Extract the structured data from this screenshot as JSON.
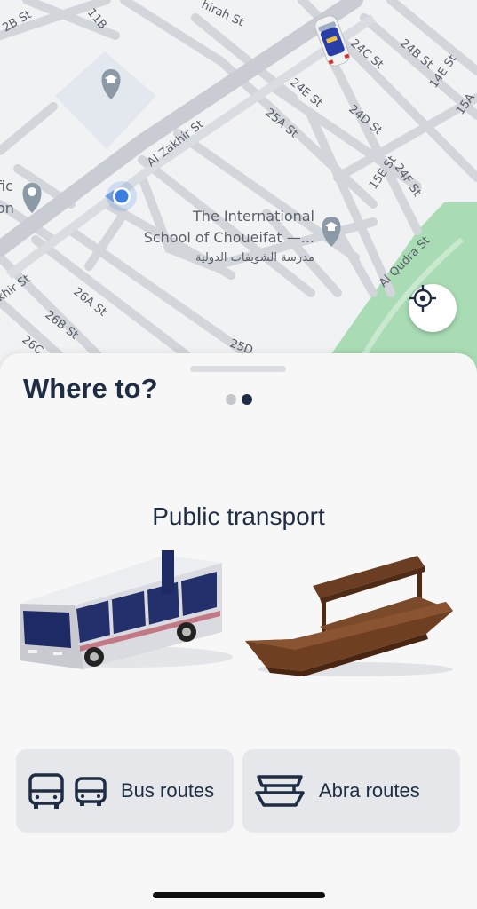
{
  "map": {
    "streets": {
      "s2b": "2B St",
      "s11b": "11B",
      "hirah": "hirah St",
      "al_zakhir": "Al Zakhir St",
      "s25a": "25A St",
      "s24e": "24E St",
      "s24d": "24D St",
      "s24b": "24B St",
      "s14e": "14E St",
      "s24c": "24C St",
      "s15e": "15E St",
      "s24f": "24F St",
      "s15a": "15A",
      "al_qudra": "Al Qudra St",
      "khir": "khir St",
      "s26a": "26A St",
      "s26b": "26B St",
      "s26c": "26C",
      "s25d": "25D"
    },
    "poi": {
      "school_en_line1": "The International",
      "school_en_line2": "School of Choueifat —...",
      "school_ar": "مدرسة الشويفات الدولية",
      "left_partial_1": "fic",
      "left_partial_2": "on"
    }
  },
  "sheet": {
    "title": "Where to?",
    "pager": {
      "count": 2,
      "active_index": 1
    },
    "subtitle": "Public transport",
    "buttons": [
      {
        "label": "Bus routes"
      },
      {
        "label": "Abra routes"
      }
    ]
  },
  "colors": {
    "primary": "#1f2d44",
    "location_dot": "#3b7fe0",
    "park": "#a9dcb5",
    "map_bg": "#f1f2f4"
  }
}
